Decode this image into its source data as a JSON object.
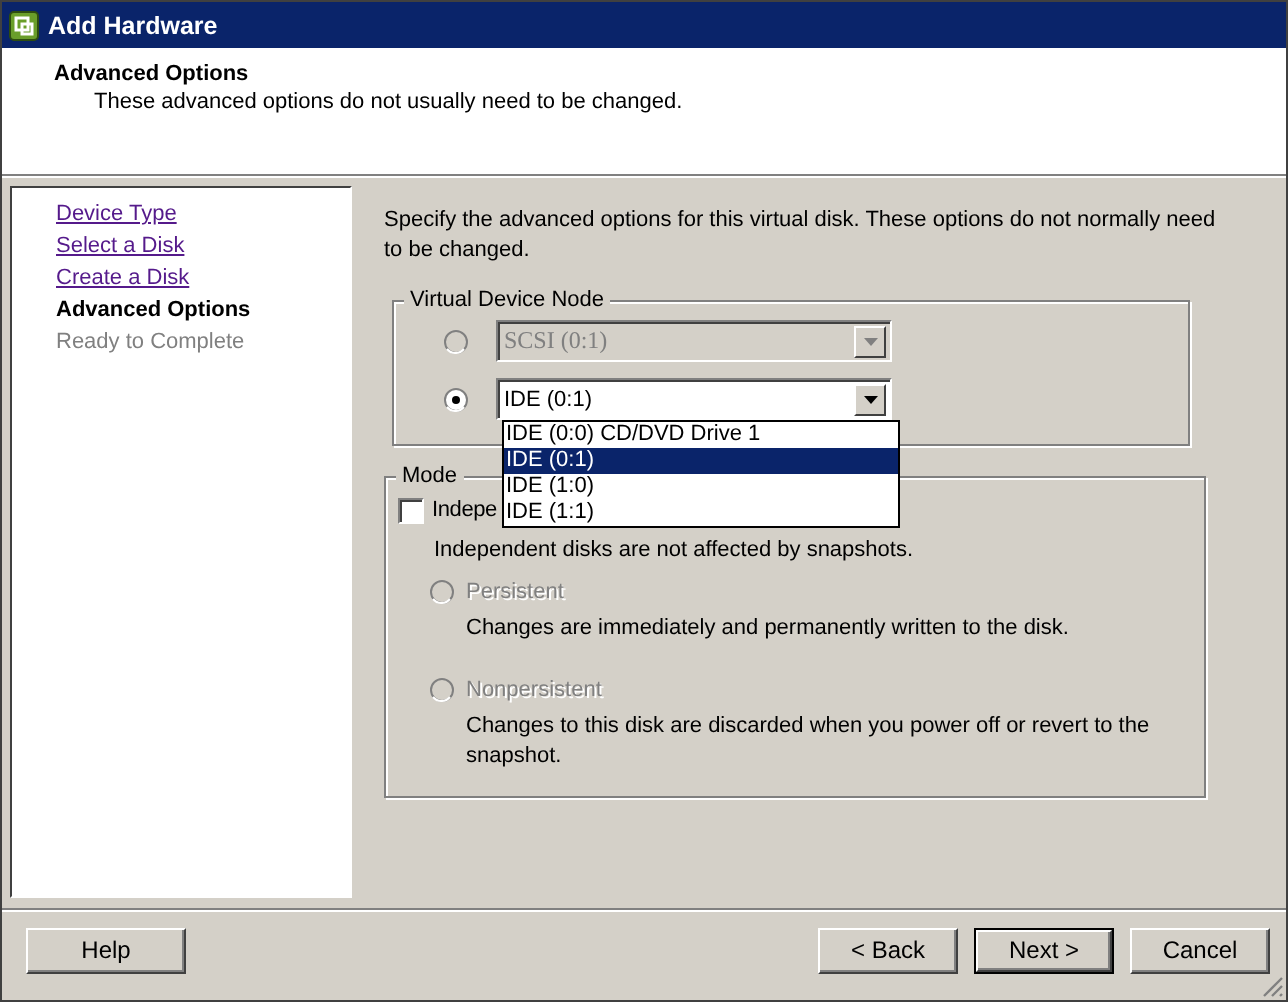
{
  "window": {
    "title": "Add Hardware"
  },
  "header": {
    "title": "Advanced Options",
    "subtitle": "These advanced options do not usually need to be changed."
  },
  "steps": [
    {
      "label": "Device Type",
      "kind": "visited"
    },
    {
      "label": "Select a Disk",
      "kind": "visited"
    },
    {
      "label": "Create a Disk",
      "kind": "visited"
    },
    {
      "label": "Advanced Options",
      "kind": "current"
    },
    {
      "label": "Ready to Complete",
      "kind": "pending"
    }
  ],
  "intro": "Specify the advanced options for this virtual disk. These options do not normally need to be changed.",
  "device_node": {
    "title": "Virtual Device Node",
    "options": [
      {
        "value": "SCSI (0:1)",
        "selected": false,
        "disabled": true
      },
      {
        "value": "IDE (0:1)",
        "selected": true,
        "disabled": false
      }
    ],
    "dropdown_list": [
      {
        "label": "IDE (0:0) CD/DVD Drive 1",
        "selected": false
      },
      {
        "label": "IDE (0:1)",
        "selected": true
      },
      {
        "label": "IDE (1:0)",
        "selected": false
      },
      {
        "label": "IDE (1:1)",
        "selected": false
      }
    ]
  },
  "mode": {
    "title": "Mode",
    "independent": {
      "label": "Indepe",
      "checked": false,
      "note": "Independent disks are not affected by snapshots."
    },
    "options": [
      {
        "label": "Persistent",
        "description": "Changes are immediately and permanently written to the disk.",
        "selected": false,
        "disabled": true
      },
      {
        "label": "Nonpersistent",
        "description": "Changes to this disk are discarded when you power off or revert to the snapshot.",
        "selected": false,
        "disabled": true
      }
    ]
  },
  "buttons": [
    {
      "label": "Help",
      "default": false
    },
    {
      "label": "< Back",
      "default": false
    },
    {
      "label": "Next >",
      "default": true
    },
    {
      "label": "Cancel",
      "default": false
    }
  ]
}
